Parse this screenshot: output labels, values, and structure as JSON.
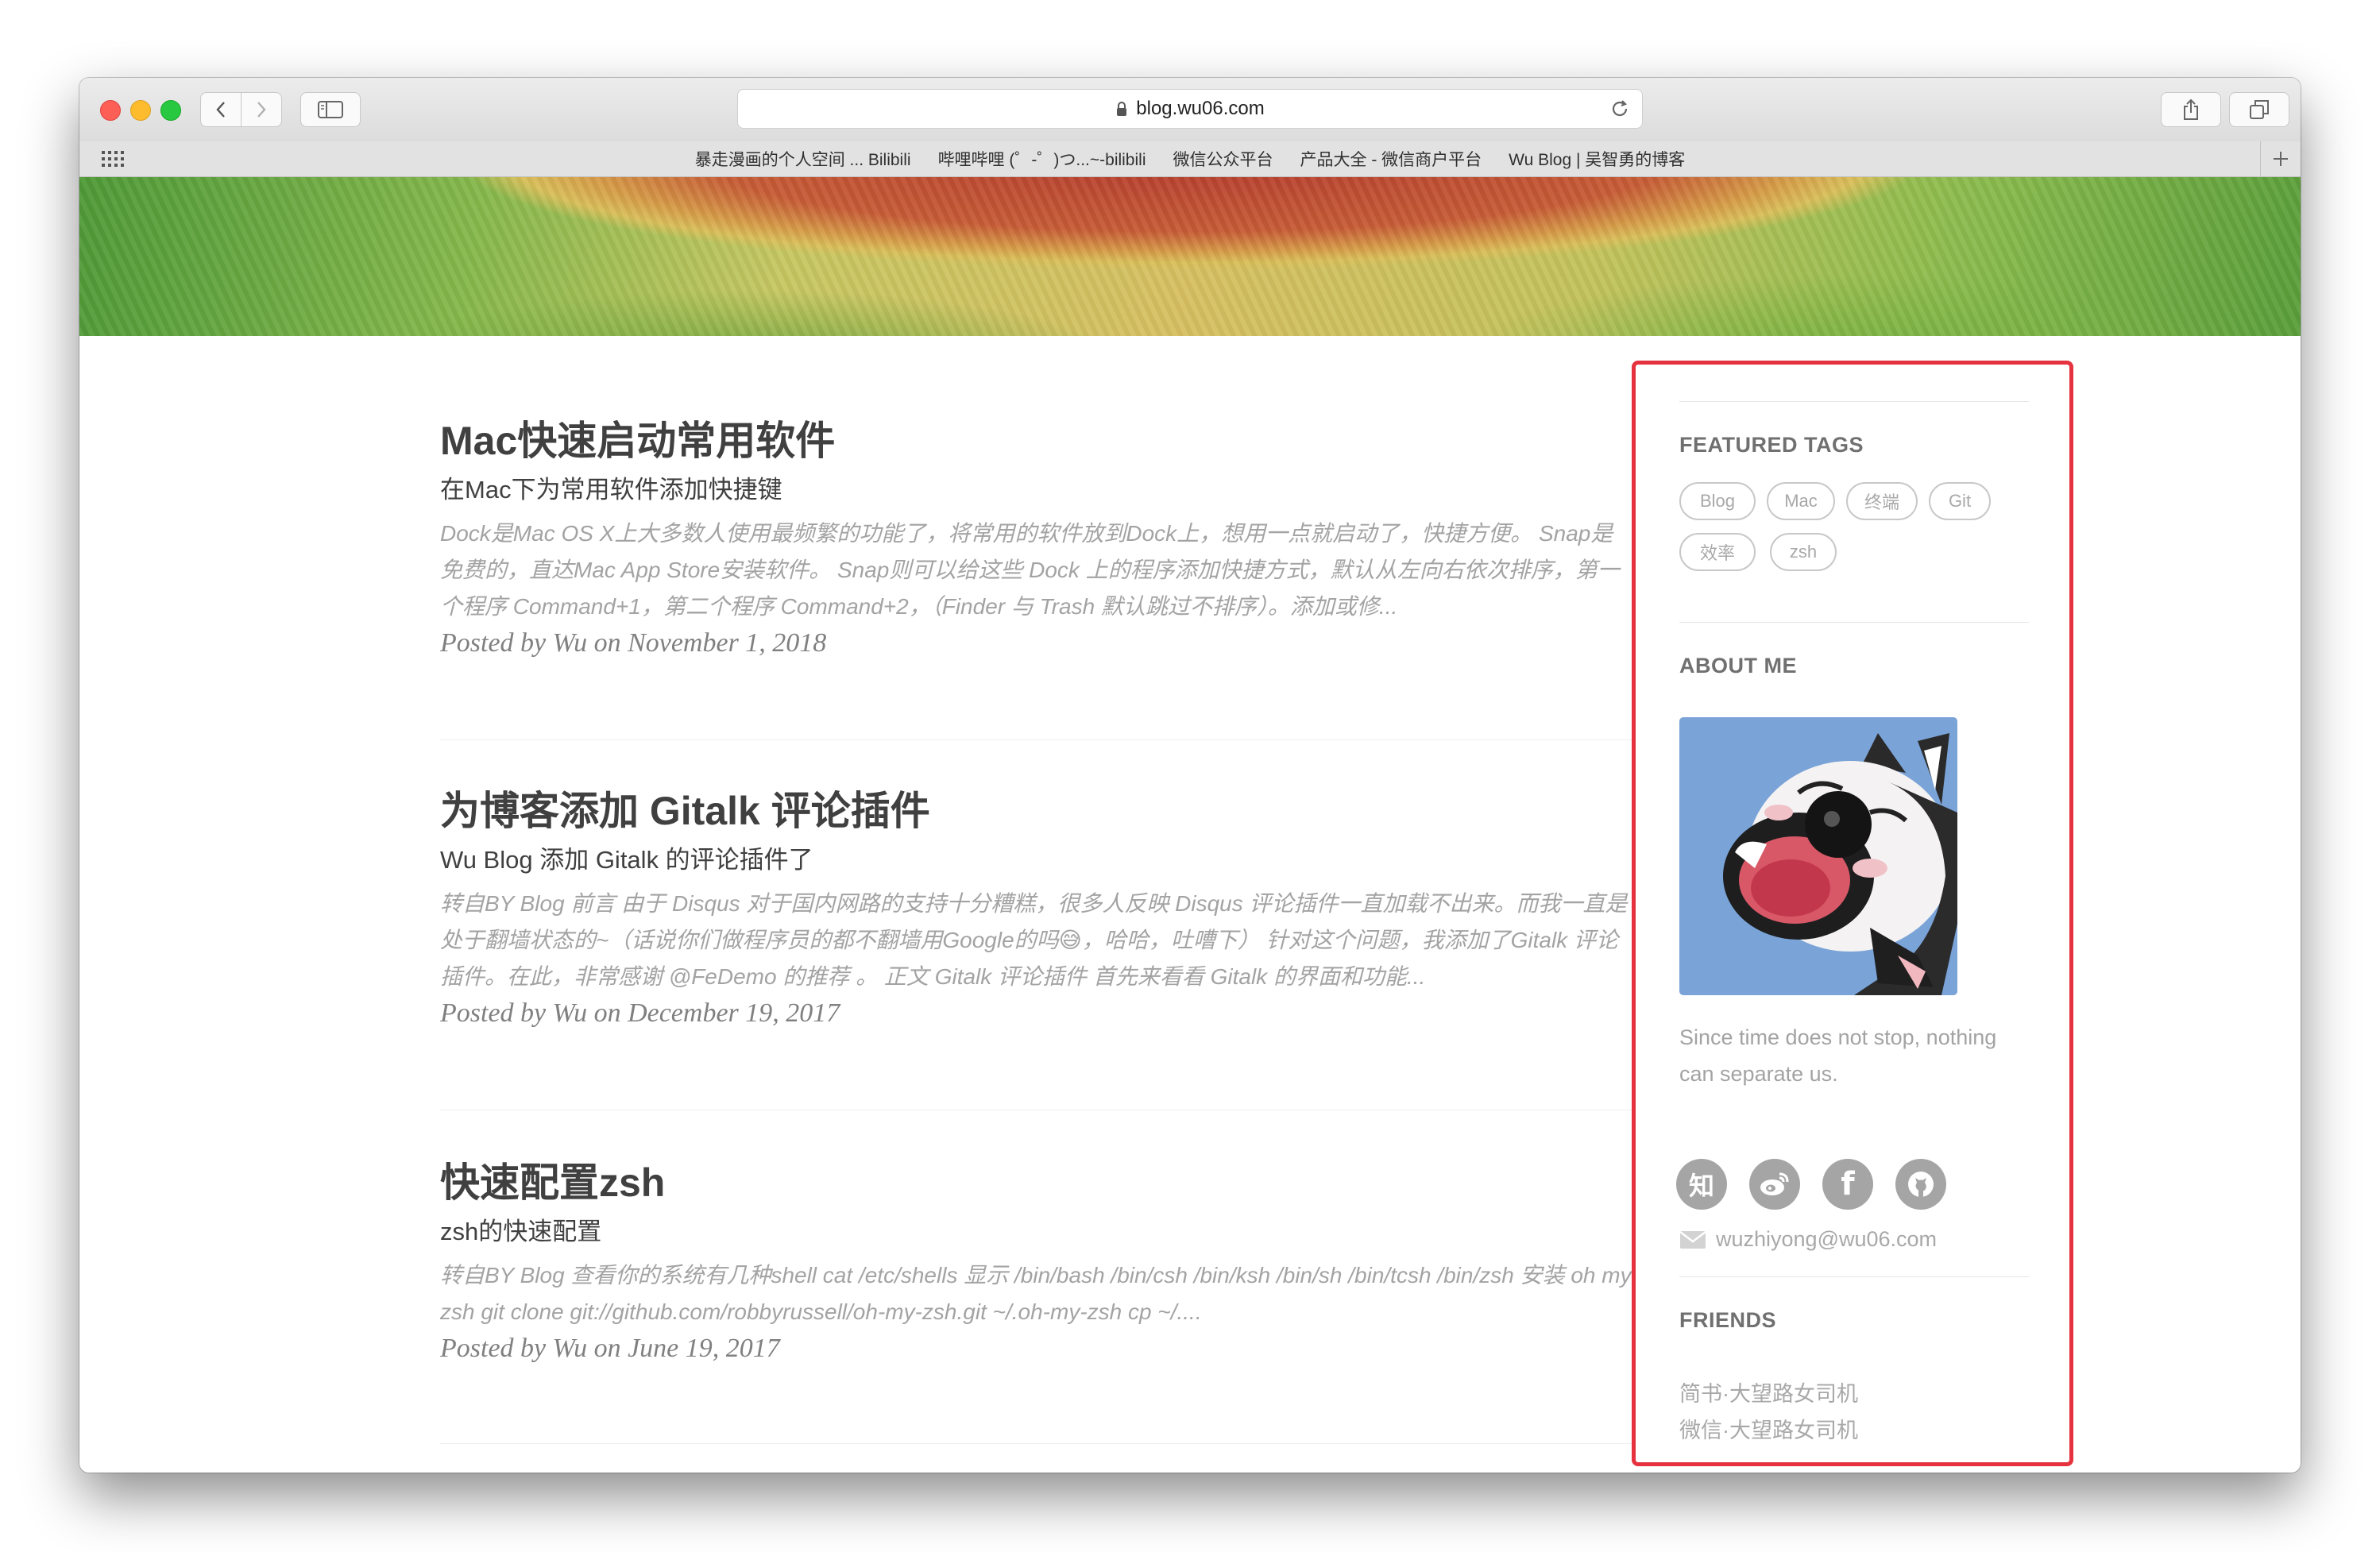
{
  "browser": {
    "url": "blog.wu06.com",
    "bookmarks": [
      "暴走漫画的个人空间 ... Bilibili",
      "哔哩哔哩 (゜-゜)つ...~-bilibili",
      "微信公众平台",
      "产品大全 - 微信商户平台",
      "Wu Blog | 吴智勇的博客"
    ]
  },
  "posts": [
    {
      "title": "Mac快速启动常用软件",
      "subtitle": "在Mac下为常用软件添加快捷键",
      "excerpt": "Dock是Mac OS X上大多数人使用最频繁的功能了，将常用的软件放到Dock上，想用一点就启动了，快捷方便。 Snap是免费的，直达Mac App Store安装软件。 Snap则可以给这些 Dock 上的程序添加快捷方式，默认从左向右依次排序，第一个程序 Command+1，第二个程序 Command+2，（Finder 与 Trash 默认跳过不排序）。添加或修...",
      "meta": "Posted by Wu on November 1, 2018"
    },
    {
      "title": "为博客添加 Gitalk 评论插件",
      "subtitle": "Wu Blog 添加 Gitalk 的评论插件了",
      "excerpt": "转自BY Blog 前言 由于 Disqus 对于国内网路的支持十分糟糕，很多人反映 Disqus 评论插件一直加载不出来。而我一直是处于翻墙状态的~（话说你们做程序员的都不翻墙用Google的吗😅，哈哈，吐嘈下） 针对这个问题，我添加了Gitalk 评论插件。在此，非常感谢 @FeDemo 的推荐 。 正文 Gitalk 评论插件 首先来看看 Gitalk 的界面和功能...",
      "meta": "Posted by Wu on December 19, 2017"
    },
    {
      "title": "快速配置zsh",
      "subtitle": "zsh的快速配置",
      "excerpt": "转自BY Blog 查看你的系统有几种shell cat /etc/shells 显示 /bin/bash /bin/csh /bin/ksh /bin/sh /bin/tcsh /bin/zsh 安装 oh my zsh git clone git://github.com/robbyrussell/oh-my-zsh.git ~/.oh-my-zsh cp ~/....",
      "meta": "Posted by Wu on June 19, 2017"
    }
  ],
  "sidebar": {
    "featured_tags_heading": "FEATURED TAGS",
    "tags": [
      "Blog",
      "Mac",
      "终端",
      "Git",
      "效率",
      "zsh"
    ],
    "about_heading": "ABOUT ME",
    "about_text": "Since time does not stop, nothing can separate us.",
    "social": [
      {
        "name": "zhihu",
        "glyph": "知"
      },
      {
        "name": "weibo",
        "glyph": ""
      },
      {
        "name": "facebook",
        "glyph": "f"
      },
      {
        "name": "github",
        "glyph": ""
      }
    ],
    "email": "wuzhiyong@wu06.com",
    "friends_heading": "FRIENDS",
    "friends": [
      "简书·大望路女司机",
      "微信·大望路女司机"
    ]
  },
  "colors": {
    "highlight": "#e5323e",
    "text_dark": "#404040",
    "text_muted": "#a3a3a3"
  }
}
